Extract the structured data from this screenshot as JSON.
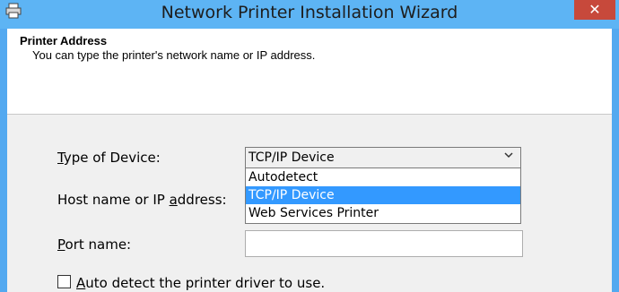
{
  "window": {
    "title": "Network Printer Installation Wizard",
    "close_symbol": "✕",
    "app_icon": "printer-icon"
  },
  "header": {
    "title": "Printer Address",
    "description": "You can type the printer's network name or IP address."
  },
  "form": {
    "device_type_label_mnemonic": "T",
    "device_type_label_rest": "ype of Device:",
    "device_type_value": "TCP/IP Device",
    "chevron": "⌄",
    "host_label_before": "Host name or IP ",
    "host_label_mnemonic": "a",
    "host_label_after": "ddress:",
    "port_label_mnemonic": "P",
    "port_label_rest": "ort name:",
    "auto_detect_mnemonic": "A",
    "auto_detect_rest": "uto detect the printer driver to use.",
    "auto_detect_checked": false
  },
  "dropdown": {
    "options": [
      "Autodetect",
      "TCP/IP Device",
      "Web Services Printer"
    ],
    "selected_index": 1
  },
  "colors": {
    "titlebar": "#5db4f4",
    "selection": "#3399ff",
    "close": "#c7493b"
  }
}
